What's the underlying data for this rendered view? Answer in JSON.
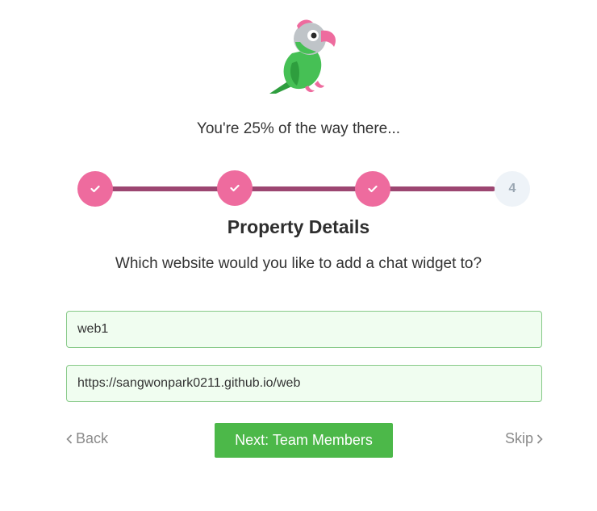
{
  "header": {
    "logo_icon": "parrot-mascot-icon",
    "progress_text": "You're 25% of the way there..."
  },
  "stepper": {
    "steps": [
      {
        "state": "done",
        "icon": "check-icon"
      },
      {
        "state": "done",
        "icon": "check-icon"
      },
      {
        "state": "done",
        "icon": "check-icon"
      },
      {
        "state": "current",
        "label": "4"
      }
    ],
    "completed_fraction": 0.75,
    "colors": {
      "done": "#ee6b9e",
      "track": "#9c4671",
      "current_bg": "#eef3f8"
    }
  },
  "main": {
    "title": "Property Details",
    "question": "Which website would you like to add a chat widget to?",
    "name_field": {
      "value": "web1"
    },
    "url_field": {
      "value": "https://sangwonpark0211.github.io/web"
    }
  },
  "footer": {
    "back_label": "Back",
    "back_icon": "chevron-left-icon",
    "next_label": "Next: Team Members",
    "skip_label": "Skip",
    "skip_icon": "chevron-right-icon",
    "accent_color": "#4cb849"
  }
}
